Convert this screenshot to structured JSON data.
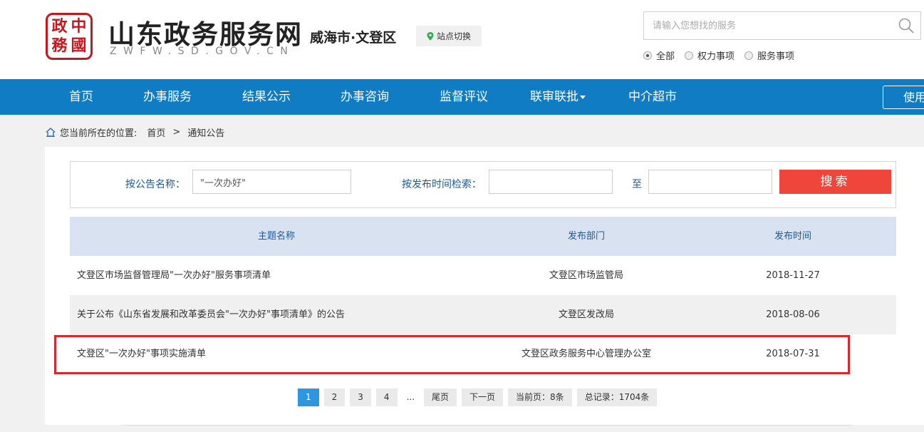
{
  "header": {
    "logo_chars": [
      "中",
      "政",
      "國",
      "務"
    ],
    "site_title": "山东政务服务网",
    "site_subtitle": "ZWFW.SD.GOV.CN",
    "region": "威海市·文登区",
    "switch_label": "站点切换",
    "search_placeholder": "请输入您想找的服务",
    "radios": [
      {
        "label": "全部",
        "checked": true
      },
      {
        "label": "权力事项",
        "checked": false
      },
      {
        "label": "服务事项",
        "checked": false
      }
    ]
  },
  "nav": {
    "items": [
      "首页",
      "办事服务",
      "结果公示",
      "办事咨询",
      "监督评议",
      "联审联批",
      "中介超市"
    ],
    "use_label": "使用"
  },
  "breadcrumb": {
    "prefix": "您当前所在的位置:",
    "home": "首页",
    "sep": ">",
    "current": "通知公告"
  },
  "filter": {
    "name_label": "按公告名称：",
    "name_value": "\"一次办好\"",
    "time_label": "按发布时间检索：",
    "to_label": "至",
    "search_label": "搜索"
  },
  "table": {
    "headers": [
      "主题名称",
      "发布部门",
      "发布时间"
    ],
    "rows": [
      {
        "title": "文登区市场监督管理局\"一次办好\"服务事项清单",
        "dept": "文登区市场监管局",
        "date": "2018-11-27"
      },
      {
        "title": "关于公布《山东省发展和改革委员会\"一次办好\"事项清单》的公告",
        "dept": "文登区发改局",
        "date": "2018-08-06"
      },
      {
        "title": "文登区\"一次办好\"事项实施清单",
        "dept": "文登区政务服务中心管理办公室",
        "date": "2018-07-31"
      }
    ]
  },
  "pager": {
    "pages": [
      "1",
      "2",
      "3",
      "4"
    ],
    "ellipsis": "...",
    "last": "尾页",
    "next": "下一页",
    "current_info": "当前页：8条",
    "total_info": "总记录：1704条"
  },
  "colors": {
    "nav_blue": "#0f7cc4",
    "search_red": "#f0453a",
    "highlight_red": "#e0242b",
    "pager_active": "#2d96e0"
  }
}
